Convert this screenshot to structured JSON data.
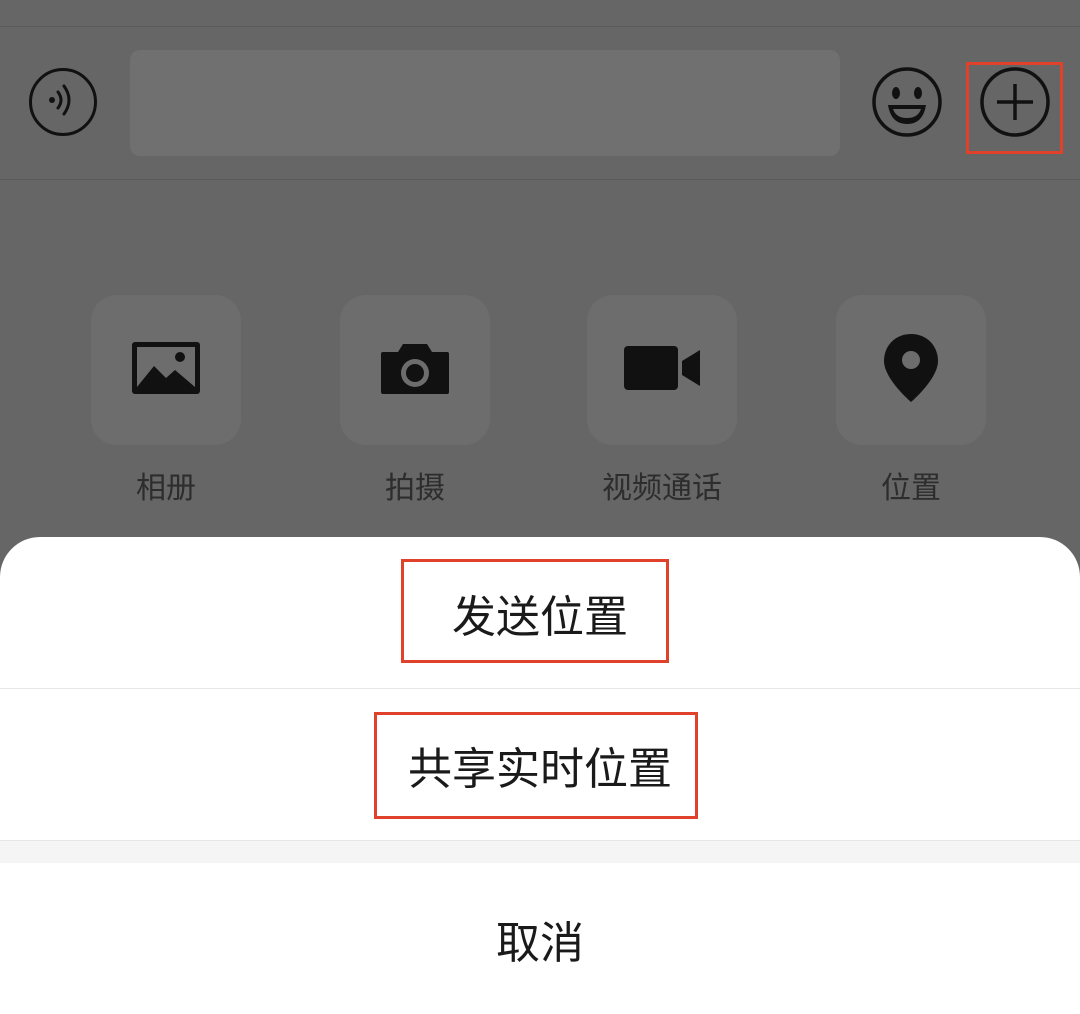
{
  "colors": {
    "overlay": "#666666",
    "sheet_bg": "#ffffff",
    "highlight": "#e0412a",
    "icon": "#111111"
  },
  "input_bar": {
    "voice_icon": "voice-icon",
    "emoji_icon": "emoji-icon",
    "plus_icon": "plus-circle-icon"
  },
  "tools": [
    {
      "label": "相册",
      "icon": "photo-album-icon"
    },
    {
      "label": "拍摄",
      "icon": "camera-icon"
    },
    {
      "label": "视频通话",
      "icon": "video-call-icon"
    },
    {
      "label": "位置",
      "icon": "location-pin-icon"
    }
  ],
  "action_sheet": {
    "send_location": "发送位置",
    "share_live_location": "共享实时位置",
    "cancel": "取消"
  }
}
